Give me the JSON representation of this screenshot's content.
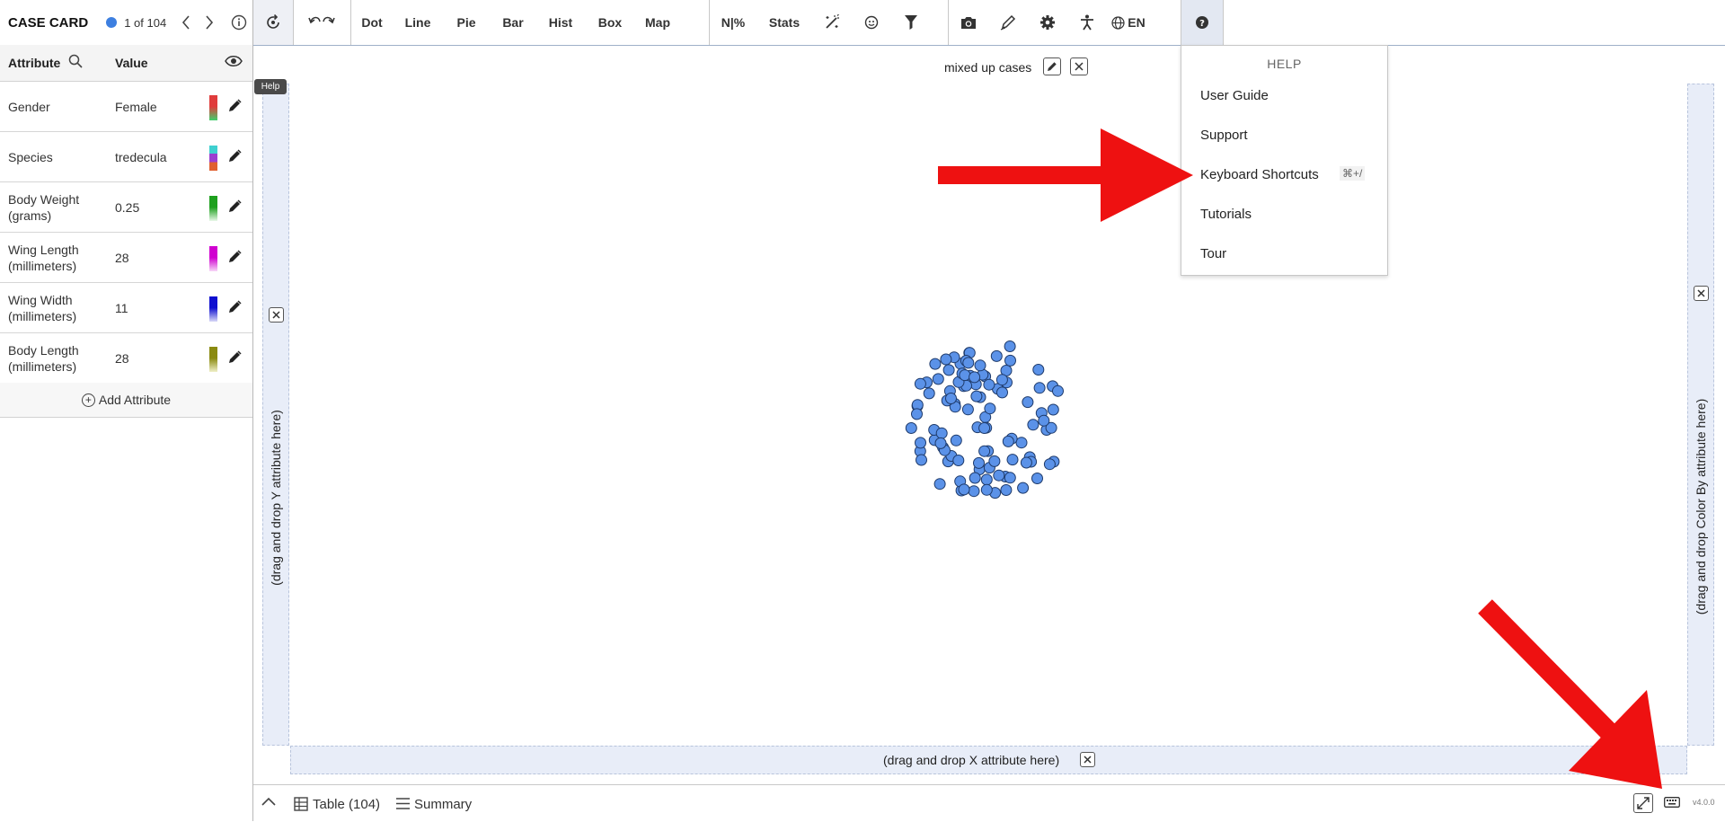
{
  "case_card": {
    "title": "CASE CARD",
    "count_label": "1 of 104",
    "header_attribute": "Attribute",
    "header_value": "Value",
    "rows": [
      {
        "name": "Gender",
        "value": "Female",
        "swatch": [
          "#e03c3c",
          "#3fd06c"
        ]
      },
      {
        "name": "Species",
        "value": "tredecula",
        "swatch": [
          "#3fd0d0",
          "#9b3fd0",
          "#e06030"
        ]
      },
      {
        "name": "Body Weight (grams)",
        "value": "0.25",
        "swatch": [
          "#1ea01e",
          "#e8f8e8"
        ]
      },
      {
        "name": "Wing Length (millimeters)",
        "value": "28",
        "swatch": [
          "#d000d0",
          "#f8d8f8"
        ]
      },
      {
        "name": "Wing Width (millimeters)",
        "value": "11",
        "swatch": [
          "#1010d0",
          "#d8d8f8"
        ]
      },
      {
        "name": "Body Length (millimeters)",
        "value": "28",
        "swatch": [
          "#8a8a10",
          "#f0f0c8"
        ]
      }
    ],
    "add_attribute": "Add Attribute"
  },
  "toolbar": {
    "dot": "Dot",
    "line": "Line",
    "pie": "Pie",
    "bar": "Bar",
    "hist": "Hist",
    "box": "Box",
    "map": "Map",
    "count_percent": "N|%",
    "stats": "Stats",
    "language": "EN"
  },
  "tooltip": "Help",
  "graph": {
    "title": "mixed up cases",
    "y_drop": "(drag and drop Y attribute here)",
    "x_drop": "(drag and drop X attribute here)",
    "color_drop": "(drag and drop Color By attribute here)",
    "point_color": "#5b92e8",
    "point_count": 104
  },
  "help_menu": {
    "header": "HELP",
    "items": [
      "User Guide",
      "Support",
      "Keyboard Shortcuts",
      "Tutorials",
      "Tour"
    ],
    "shortcut": "⌘+/"
  },
  "bottom_bar": {
    "table": "Table (104)",
    "summary": "Summary",
    "version": "v4.0.0"
  },
  "annotation_color": "#ee1111"
}
